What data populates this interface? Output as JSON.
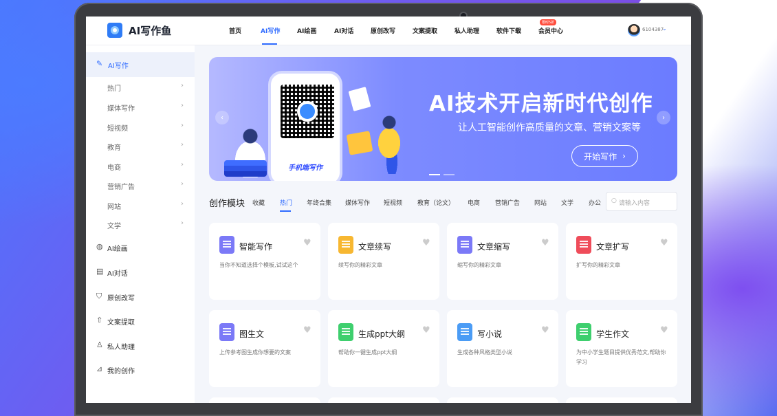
{
  "app": {
    "name": "AI写作鱼"
  },
  "nav": {
    "items": [
      {
        "label": "首页"
      },
      {
        "label": "AI写作",
        "active": true
      },
      {
        "label": "AI绘画"
      },
      {
        "label": "AI对话"
      },
      {
        "label": "原创改写"
      },
      {
        "label": "文案提取"
      },
      {
        "label": "私人助理"
      },
      {
        "label": "软件下载"
      },
      {
        "label": "会员中心",
        "badge": "限时5折"
      }
    ],
    "user_id": "6104387",
    "accent": "#2f6bff"
  },
  "sidebar": {
    "header": {
      "label": "AI写作",
      "icon": "pen-icon"
    },
    "sub_items": [
      "热门",
      "媒体写作",
      "短视频",
      "教育",
      "电商",
      "营销广告",
      "网站",
      "文学"
    ],
    "main_items": [
      {
        "label": "AI绘画",
        "icon": "palette-icon"
      },
      {
        "label": "AI对话",
        "icon": "chat-icon"
      },
      {
        "label": "原创改写",
        "icon": "shield-icon"
      },
      {
        "label": "文案提取",
        "icon": "upload-icon"
      },
      {
        "label": "私人助理",
        "icon": "user-icon"
      },
      {
        "label": "我的创作",
        "icon": "chart-icon"
      }
    ]
  },
  "banner": {
    "title": "AI技术开启新时代创作",
    "subtitle": "让人工智能创作高质量的文章、营销文案等",
    "cta": "开始写作",
    "phone_label": "手机端写作"
  },
  "modules": {
    "title": "创作模块",
    "tabs": [
      "收藏",
      "热门",
      "年终合集",
      "媒体写作",
      "短视频",
      "教育（论文）",
      "电商",
      "营销广告",
      "网站",
      "文学",
      "办公"
    ],
    "active_tab": "热门",
    "search_placeholder": "请输入内容"
  },
  "cards": [
    {
      "title": "智能写作",
      "desc": "当你不知道选择个模板,试试这个",
      "color": "#7b79f7"
    },
    {
      "title": "文章续写",
      "desc": "续写你的精彩文章",
      "color": "#f7b731"
    },
    {
      "title": "文章缩写",
      "desc": "缩写你的精彩文章",
      "color": "#7b79f7"
    },
    {
      "title": "文章扩写",
      "desc": "扩写你的精彩文章",
      "color": "#ef4c5a"
    },
    {
      "title": "图生文",
      "desc": "上传参考图生成你想要的文案",
      "color": "#7b79f7"
    },
    {
      "title": "生成ppt大纲",
      "desc": "帮助你一键生成ppt大纲",
      "color": "#3ecf6e"
    },
    {
      "title": "写小说",
      "desc": "生成各种风格类型小说",
      "color": "#4b9cf5"
    },
    {
      "title": "学生作文",
      "desc": "为中小学生题目提供优秀范文,帮助你学习",
      "color": "#3ecf6e"
    }
  ]
}
